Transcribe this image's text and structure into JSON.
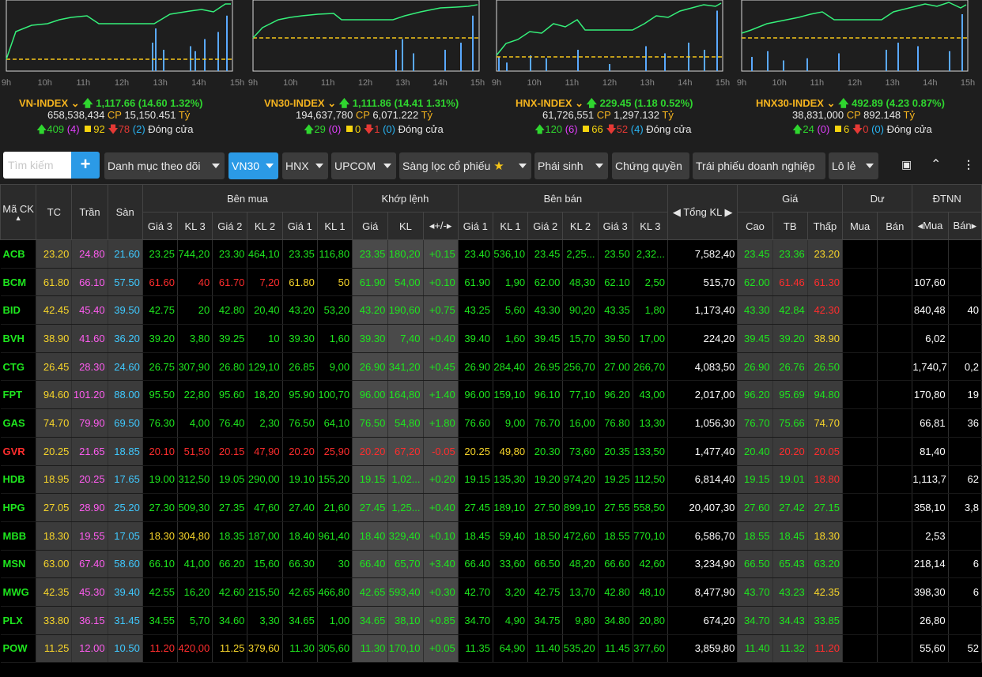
{
  "colors": {
    "up": "#1ee61e",
    "down": "#ff2d2d",
    "ref": "#f7d52a",
    "ceil": "#ff5cf0",
    "floor": "#3fc9ff",
    "accent": "#2b9ae6",
    "index_name": "#f5b41e"
  },
  "indices": [
    {
      "name": "VN-INDEX",
      "value": "1,117.66",
      "change": "(14.60 1.32%)",
      "volume": "658,538,434",
      "cp_label": "CP",
      "turnover": "15,150.451",
      "unit": "Tỷ",
      "up": "409",
      "ceil": "(4)",
      "ref": "92",
      "down": "78",
      "floor": "(2)",
      "status": "Đóng cửa",
      "ticks": [
        "9h",
        "10h",
        "11h",
        "12h",
        "13h",
        "14h",
        "15h"
      ]
    },
    {
      "name": "VN30-INDEX",
      "value": "1,111.86",
      "change": "(14.41 1.31%)",
      "volume": "194,637,780",
      "cp_label": "CP",
      "turnover": "6,071.222",
      "unit": "Tỷ",
      "up": "29",
      "ceil": "(0)",
      "ref": "0",
      "down": "1",
      "floor": "(0)",
      "status": "Đóng cửa",
      "ticks": [
        "9h",
        "10h",
        "11h",
        "12h",
        "13h",
        "14h",
        "15h"
      ]
    },
    {
      "name": "HNX-INDEX",
      "value": "229.45",
      "change": "(1.18 0.52%)",
      "volume": "61,726,551",
      "cp_label": "CP",
      "turnover": "1,297.132",
      "unit": "Tỷ",
      "up": "120",
      "ceil": "(6)",
      "ref": "66",
      "down": "52",
      "floor": "(4)",
      "status": "Đóng cửa",
      "ticks": [
        "9h",
        "10h",
        "11h",
        "12h",
        "13h",
        "14h",
        "15h"
      ]
    },
    {
      "name": "HNX30-INDEX",
      "value": "492.89",
      "change": "(4.23 0.87%)",
      "volume": "38,831,000",
      "cp_label": "CP",
      "turnover": "892.148",
      "unit": "Tỷ",
      "up": "24",
      "ceil": "(0)",
      "ref": "6",
      "down": "0",
      "floor": "(0)",
      "status": "Đóng cửa",
      "ticks": [
        "9h",
        "10h",
        "11h",
        "12h",
        "13h",
        "14h",
        "15h"
      ]
    }
  ],
  "toolbar": {
    "search_placeholder": "Tìm kiếm",
    "add_label": "+",
    "buttons": [
      "Danh mục theo dõi",
      "VN30",
      "HNX",
      "UPCOM",
      "Sàng lọc cổ phiếu",
      "Phái sinh",
      "Chứng quyền",
      "Trái phiếu doanh nghiệp",
      "Lô lẻ"
    ]
  },
  "table": {
    "headers": {
      "symbol": "Mã CK",
      "tc": "TC",
      "tran": "Trần",
      "san": "Sàn",
      "ben_mua": "Bên mua",
      "khop_lenh": "Khớp lệnh",
      "ben_ban": "Bên bán",
      "tong_kl": "Tổng KL",
      "gia": "Giá",
      "du": "Dư",
      "dtnn": "ĐTNN",
      "gia3": "Giá 3",
      "kl3": "KL 3",
      "gia2": "Giá 2",
      "kl2": "KL 2",
      "gia1": "Giá 1",
      "kl1": "KL 1",
      "kl": "KL",
      "change": "+/-",
      "cao": "Cao",
      "tb": "TB",
      "thap": "Thấp",
      "mua": "Mua",
      "ban": "Bán",
      "nn_mua": "Mua",
      "nn_ban": "Bán"
    },
    "rows": [
      {
        "sym": "ACB",
        "s": "u",
        "tc": "23.20",
        "tran": "24.80",
        "san": "21.60",
        "b3": "23.25",
        "b3c": "u",
        "bk3": "744,20",
        "b2": "23.30",
        "b2c": "u",
        "bk2": "464,10",
        "b1": "23.35",
        "b1c": "u",
        "bk1": "116,80",
        "m": "23.35",
        "mc": "u",
        "mk": "180,20",
        "ch": "+0.15",
        "s1": "23.40",
        "s1c": "u",
        "sk1": "536,10",
        "s2": "23.45",
        "s2c": "u",
        "sk2": "2,25...",
        "s3": "23.50",
        "s3c": "u",
        "sk3": "2,32...",
        "tot": "7,582,40",
        "hi": "23.45",
        "hic": "u",
        "av": "23.36",
        "avc": "u",
        "lo": "23.20",
        "loc": "r",
        "dm": "",
        "db": "",
        "nm": "",
        "nb": ""
      },
      {
        "sym": "BCM",
        "s": "u",
        "tc": "61.80",
        "tran": "66.10",
        "san": "57.50",
        "b3": "61.60",
        "b3c": "d",
        "bk3": "40",
        "b2": "61.70",
        "b2c": "d",
        "bk2": "7,20",
        "b1": "61.80",
        "b1c": "r",
        "bk1": "50",
        "m": "61.90",
        "mc": "u",
        "mk": "54,00",
        "ch": "+0.10",
        "s1": "61.90",
        "s1c": "u",
        "sk1": "1,90",
        "s2": "62.00",
        "s2c": "u",
        "sk2": "48,30",
        "s3": "62.10",
        "s3c": "u",
        "sk3": "2,50",
        "tot": "515,70",
        "hi": "62.00",
        "hic": "u",
        "av": "61.46",
        "avc": "d",
        "lo": "61.30",
        "loc": "d",
        "dm": "",
        "db": "",
        "nm": "107,60",
        "nb": ""
      },
      {
        "sym": "BID",
        "s": "u",
        "tc": "42.45",
        "tran": "45.40",
        "san": "39.50",
        "b3": "42.75",
        "b3c": "u",
        "bk3": "20",
        "b2": "42.80",
        "b2c": "u",
        "bk2": "20,40",
        "b1": "43.20",
        "b1c": "u",
        "bk1": "53,20",
        "m": "43.20",
        "mc": "u",
        "mk": "190,60",
        "ch": "+0.75",
        "s1": "43.25",
        "s1c": "u",
        "sk1": "5,60",
        "s2": "43.30",
        "s2c": "u",
        "sk2": "90,20",
        "s3": "43.35",
        "s3c": "u",
        "sk3": "1,80",
        "tot": "1,173,40",
        "hi": "43.30",
        "hic": "u",
        "av": "42.84",
        "avc": "u",
        "lo": "42.30",
        "loc": "d",
        "dm": "",
        "db": "",
        "nm": "840,48",
        "nb": "40"
      },
      {
        "sym": "BVH",
        "s": "u",
        "tc": "38.90",
        "tran": "41.60",
        "san": "36.20",
        "b3": "39.20",
        "b3c": "u",
        "bk3": "3,80",
        "b2": "39.25",
        "b2c": "u",
        "bk2": "10",
        "b1": "39.30",
        "b1c": "u",
        "bk1": "1,60",
        "m": "39.30",
        "mc": "u",
        "mk": "7,40",
        "ch": "+0.40",
        "s1": "39.40",
        "s1c": "u",
        "sk1": "1,60",
        "s2": "39.45",
        "s2c": "u",
        "sk2": "15,70",
        "s3": "39.50",
        "s3c": "u",
        "sk3": "17,00",
        "tot": "224,20",
        "hi": "39.45",
        "hic": "u",
        "av": "39.20",
        "avc": "u",
        "lo": "38.90",
        "loc": "r",
        "dm": "",
        "db": "",
        "nm": "6,02",
        "nb": ""
      },
      {
        "sym": "CTG",
        "s": "u",
        "tc": "26.45",
        "tran": "28.30",
        "san": "24.60",
        "b3": "26.75",
        "b3c": "u",
        "bk3": "307,90",
        "b2": "26.80",
        "b2c": "u",
        "bk2": "129,10",
        "b1": "26.85",
        "b1c": "u",
        "bk1": "9,00",
        "m": "26.90",
        "mc": "u",
        "mk": "341,20",
        "ch": "+0.45",
        "s1": "26.90",
        "s1c": "u",
        "sk1": "284,40",
        "s2": "26.95",
        "s2c": "u",
        "sk2": "256,70",
        "s3": "27.00",
        "s3c": "u",
        "sk3": "266,70",
        "tot": "4,083,50",
        "hi": "26.90",
        "hic": "u",
        "av": "26.76",
        "avc": "u",
        "lo": "26.50",
        "loc": "u",
        "dm": "",
        "db": "",
        "nm": "1,740,7",
        "nb": "0,2"
      },
      {
        "sym": "FPT",
        "s": "u",
        "tc": "94.60",
        "tran": "101.20",
        "san": "88.00",
        "b3": "95.50",
        "b3c": "u",
        "bk3": "22,80",
        "b2": "95.60",
        "b2c": "u",
        "bk2": "18,20",
        "b1": "95.90",
        "b1c": "u",
        "bk1": "100,70",
        "m": "96.00",
        "mc": "u",
        "mk": "164,80",
        "ch": "+1.40",
        "s1": "96.00",
        "s1c": "u",
        "sk1": "159,10",
        "s2": "96.10",
        "s2c": "u",
        "sk2": "77,10",
        "s3": "96.20",
        "s3c": "u",
        "sk3": "43,00",
        "tot": "2,017,00",
        "hi": "96.20",
        "hic": "u",
        "av": "95.69",
        "avc": "u",
        "lo": "94.80",
        "loc": "u",
        "dm": "",
        "db": "",
        "nm": "170,80",
        "nb": "19"
      },
      {
        "sym": "GAS",
        "s": "u",
        "tc": "74.70",
        "tran": "79.90",
        "san": "69.50",
        "b3": "76.30",
        "b3c": "u",
        "bk3": "4,00",
        "b2": "76.40",
        "b2c": "u",
        "bk2": "2,30",
        "b1": "76.50",
        "b1c": "u",
        "bk1": "64,10",
        "m": "76.50",
        "mc": "u",
        "mk": "54,80",
        "ch": "+1.80",
        "s1": "76.60",
        "s1c": "u",
        "sk1": "9,00",
        "s2": "76.70",
        "s2c": "u",
        "sk2": "16,00",
        "s3": "76.80",
        "s3c": "u",
        "sk3": "13,30",
        "tot": "1,056,30",
        "hi": "76.70",
        "hic": "u",
        "av": "75.66",
        "avc": "u",
        "lo": "74.70",
        "loc": "r",
        "dm": "",
        "db": "",
        "nm": "66,81",
        "nb": "36"
      },
      {
        "sym": "GVR",
        "s": "d",
        "tc": "20.25",
        "tran": "21.65",
        "san": "18.85",
        "b3": "20.10",
        "b3c": "d",
        "bk3": "51,50",
        "b2": "20.15",
        "b2c": "d",
        "bk2": "47,90",
        "b1": "20.20",
        "b1c": "d",
        "bk1": "25,90",
        "m": "20.20",
        "mc": "d",
        "mk": "67,20",
        "ch": "-0.05",
        "s1": "20.25",
        "s1c": "r",
        "sk1": "49,80",
        "s2": "20.30",
        "s2c": "u",
        "sk2": "73,60",
        "s3": "20.35",
        "s3c": "u",
        "sk3": "133,50",
        "tot": "1,477,40",
        "hi": "20.40",
        "hic": "u",
        "av": "20.20",
        "avc": "d",
        "lo": "20.05",
        "loc": "d",
        "dm": "",
        "db": "",
        "nm": "81,40",
        "nb": ""
      },
      {
        "sym": "HDB",
        "s": "u",
        "tc": "18.95",
        "tran": "20.25",
        "san": "17.65",
        "b3": "19.00",
        "b3c": "u",
        "bk3": "312,50",
        "b2": "19.05",
        "b2c": "u",
        "bk2": "290,00",
        "b1": "19.10",
        "b1c": "u",
        "bk1": "155,20",
        "m": "19.15",
        "mc": "u",
        "mk": "1,02...",
        "ch": "+0.20",
        "s1": "19.15",
        "s1c": "u",
        "sk1": "135,30",
        "s2": "19.20",
        "s2c": "u",
        "sk2": "974,20",
        "s3": "19.25",
        "s3c": "u",
        "sk3": "112,50",
        "tot": "6,814,40",
        "hi": "19.15",
        "hic": "u",
        "av": "19.01",
        "avc": "u",
        "lo": "18.80",
        "loc": "d",
        "dm": "",
        "db": "",
        "nm": "1,113,7",
        "nb": "62"
      },
      {
        "sym": "HPG",
        "s": "u",
        "tc": "27.05",
        "tran": "28.90",
        "san": "25.20",
        "b3": "27.30",
        "b3c": "u",
        "bk3": "509,30",
        "b2": "27.35",
        "b2c": "u",
        "bk2": "47,60",
        "b1": "27.40",
        "b1c": "u",
        "bk1": "21,60",
        "m": "27.45",
        "mc": "u",
        "mk": "1,25...",
        "ch": "+0.40",
        "s1": "27.45",
        "s1c": "u",
        "sk1": "189,10",
        "s2": "27.50",
        "s2c": "u",
        "sk2": "899,10",
        "s3": "27.55",
        "s3c": "u",
        "sk3": "558,50",
        "tot": "20,407,30",
        "hi": "27.60",
        "hic": "u",
        "av": "27.42",
        "avc": "u",
        "lo": "27.15",
        "loc": "u",
        "dm": "",
        "db": "",
        "nm": "358,10",
        "nb": "3,8"
      },
      {
        "sym": "MBB",
        "s": "u",
        "tc": "18.30",
        "tran": "19.55",
        "san": "17.05",
        "b3": "18.30",
        "b3c": "r",
        "bk3": "304,80",
        "b2": "18.35",
        "b2c": "u",
        "bk2": "187,00",
        "b1": "18.40",
        "b1c": "u",
        "bk1": "961,40",
        "m": "18.40",
        "mc": "u",
        "mk": "329,40",
        "ch": "+0.10",
        "s1": "18.45",
        "s1c": "u",
        "sk1": "59,40",
        "s2": "18.50",
        "s2c": "u",
        "sk2": "472,60",
        "s3": "18.55",
        "s3c": "u",
        "sk3": "770,10",
        "tot": "6,586,70",
        "hi": "18.55",
        "hic": "u",
        "av": "18.45",
        "avc": "u",
        "lo": "18.30",
        "loc": "r",
        "dm": "",
        "db": "",
        "nm": "2,53",
        "nb": ""
      },
      {
        "sym": "MSN",
        "s": "u",
        "tc": "63.00",
        "tran": "67.40",
        "san": "58.60",
        "b3": "66.10",
        "b3c": "u",
        "bk3": "41,00",
        "b2": "66.20",
        "b2c": "u",
        "bk2": "15,60",
        "b1": "66.30",
        "b1c": "u",
        "bk1": "30",
        "m": "66.40",
        "mc": "u",
        "mk": "65,70",
        "ch": "+3.40",
        "s1": "66.40",
        "s1c": "u",
        "sk1": "33,60",
        "s2": "66.50",
        "s2c": "u",
        "sk2": "48,20",
        "s3": "66.60",
        "s3c": "u",
        "sk3": "42,60",
        "tot": "3,234,90",
        "hi": "66.50",
        "hic": "u",
        "av": "65.43",
        "avc": "u",
        "lo": "63.20",
        "loc": "u",
        "dm": "",
        "db": "",
        "nm": "218,14",
        "nb": "6"
      },
      {
        "sym": "MWG",
        "s": "u",
        "tc": "42.35",
        "tran": "45.30",
        "san": "39.40",
        "b3": "42.55",
        "b3c": "u",
        "bk3": "16,20",
        "b2": "42.60",
        "b2c": "u",
        "bk2": "215,50",
        "b1": "42.65",
        "b1c": "u",
        "bk1": "466,80",
        "m": "42.65",
        "mc": "u",
        "mk": "593,40",
        "ch": "+0.30",
        "s1": "42.70",
        "s1c": "u",
        "sk1": "3,20",
        "s2": "42.75",
        "s2c": "u",
        "sk2": "13,70",
        "s3": "42.80",
        "s3c": "u",
        "sk3": "48,10",
        "tot": "8,477,90",
        "hi": "43.70",
        "hic": "u",
        "av": "43.23",
        "avc": "u",
        "lo": "42.35",
        "loc": "r",
        "dm": "",
        "db": "",
        "nm": "398,30",
        "nb": "6"
      },
      {
        "sym": "PLX",
        "s": "u",
        "tc": "33.80",
        "tran": "36.15",
        "san": "31.45",
        "b3": "34.55",
        "b3c": "u",
        "bk3": "5,70",
        "b2": "34.60",
        "b2c": "u",
        "bk2": "3,30",
        "b1": "34.65",
        "b1c": "u",
        "bk1": "1,00",
        "m": "34.65",
        "mc": "u",
        "mk": "38,10",
        "ch": "+0.85",
        "s1": "34.70",
        "s1c": "u",
        "sk1": "4,90",
        "s2": "34.75",
        "s2c": "u",
        "sk2": "9,80",
        "s3": "34.80",
        "s3c": "u",
        "sk3": "20,80",
        "tot": "674,20",
        "hi": "34.70",
        "hic": "u",
        "av": "34.43",
        "avc": "u",
        "lo": "33.85",
        "loc": "u",
        "dm": "",
        "db": "",
        "nm": "26,80",
        "nb": ""
      },
      {
        "sym": "POW",
        "s": "u",
        "tc": "11.25",
        "tran": "12.00",
        "san": "10.50",
        "b3": "11.20",
        "b3c": "d",
        "bk3": "420,00",
        "b2": "11.25",
        "b2c": "r",
        "bk2": "379,60",
        "b1": "11.30",
        "b1c": "u",
        "bk1": "305,60",
        "m": "11.30",
        "mc": "u",
        "mk": "170,10",
        "ch": "+0.05",
        "s1": "11.35",
        "s1c": "u",
        "sk1": "64,90",
        "s2": "11.40",
        "s2c": "u",
        "sk2": "535,20",
        "s3": "11.45",
        "s3c": "u",
        "sk3": "377,60",
        "tot": "3,859,80",
        "hi": "11.40",
        "hic": "u",
        "av": "11.32",
        "avc": "u",
        "lo": "11.20",
        "loc": "d",
        "dm": "",
        "db": "",
        "nm": "55,60",
        "nb": "52"
      }
    ]
  }
}
